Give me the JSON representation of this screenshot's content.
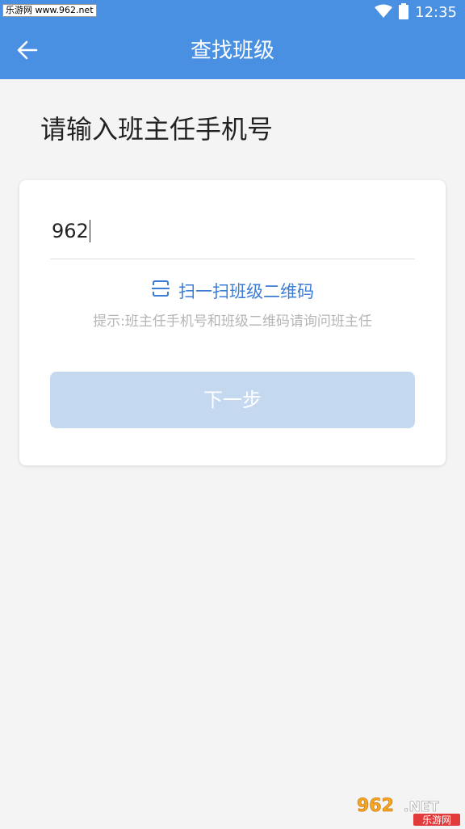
{
  "status_bar": {
    "watermark": "乐游网 www.962.net",
    "time": "12:35"
  },
  "app_bar": {
    "title": "查找班级",
    "back_icon": "arrow-left-icon"
  },
  "page": {
    "heading": "请输入班主任手机号"
  },
  "form": {
    "phone_value": "962",
    "scan_label": "扫一扫班级二维码",
    "scan_icon": "scan-icon",
    "hint": "提示:班主任手机号和班级二维码请询问班主任",
    "next_label": "下一步"
  },
  "watermark_logo": {
    "text_top": "962.NET",
    "text_bottom": "乐游网"
  },
  "colors": {
    "primary": "#4a90e2",
    "link": "#3b7dd6",
    "button_disabled": "#c4d9f0",
    "background": "#f4f4f4"
  }
}
